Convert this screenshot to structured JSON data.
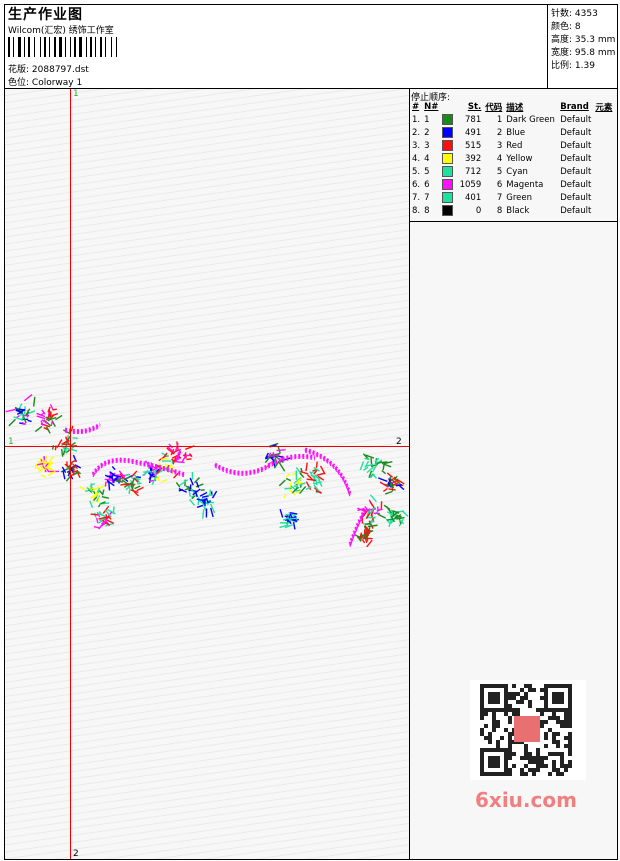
{
  "header": {
    "title": "生产作业图",
    "company": "Wilcom(汇宏) 绣饰工作室",
    "design_label": "花版:",
    "design_file": "2088797.dst",
    "colorway_label": "色位:",
    "colorway": "Colorway 1"
  },
  "stats": {
    "stitches_label": "针数:",
    "stitches": "4353",
    "colors_label": "颜色:",
    "colors": "8",
    "height_label": "高度:",
    "height": "35.3 mm",
    "width_label": "宽度:",
    "width": "95.8 mm",
    "ratio_label": "比例:",
    "ratio": "1.39"
  },
  "stop_sequence": {
    "title": "停止顺序:",
    "headers": [
      "#",
      "N#",
      "St.",
      "代码",
      "描述",
      "Brand",
      "元素"
    ],
    "rows": [
      {
        "idx": "1.",
        "n": "1",
        "color": "#1a8a1a",
        "st": "781",
        "code": "1",
        "desc": "Dark Green",
        "brand": "Default"
      },
      {
        "idx": "2.",
        "n": "2",
        "color": "#0000ff",
        "st": "491",
        "code": "2",
        "desc": "Blue",
        "brand": "Default"
      },
      {
        "idx": "3.",
        "n": "3",
        "color": "#ff1010",
        "st": "515",
        "code": "3",
        "desc": "Red",
        "brand": "Default"
      },
      {
        "idx": "4.",
        "n": "4",
        "color": "#ffff00",
        "st": "392",
        "code": "4",
        "desc": "Yellow",
        "brand": "Default"
      },
      {
        "idx": "5.",
        "n": "5",
        "color": "#20e0a0",
        "st": "712",
        "code": "5",
        "desc": "Cyan",
        "brand": "Default"
      },
      {
        "idx": "6.",
        "n": "6",
        "color": "#ff10ff",
        "st": "1059",
        "code": "6",
        "desc": "Magenta",
        "brand": "Default"
      },
      {
        "idx": "7.",
        "n": "7",
        "color": "#20e0a0",
        "st": "401",
        "code": "7",
        "desc": "Green",
        "brand": "Default"
      },
      {
        "idx": "8.",
        "n": "8",
        "color": "#000000",
        "st": "0",
        "code": "8",
        "desc": "Black",
        "brand": "Default"
      }
    ]
  },
  "axes": {
    "v_top": "1",
    "v_bottom": "2",
    "h_left": "1",
    "h_right": "2"
  },
  "watermark": "6xiu.com"
}
